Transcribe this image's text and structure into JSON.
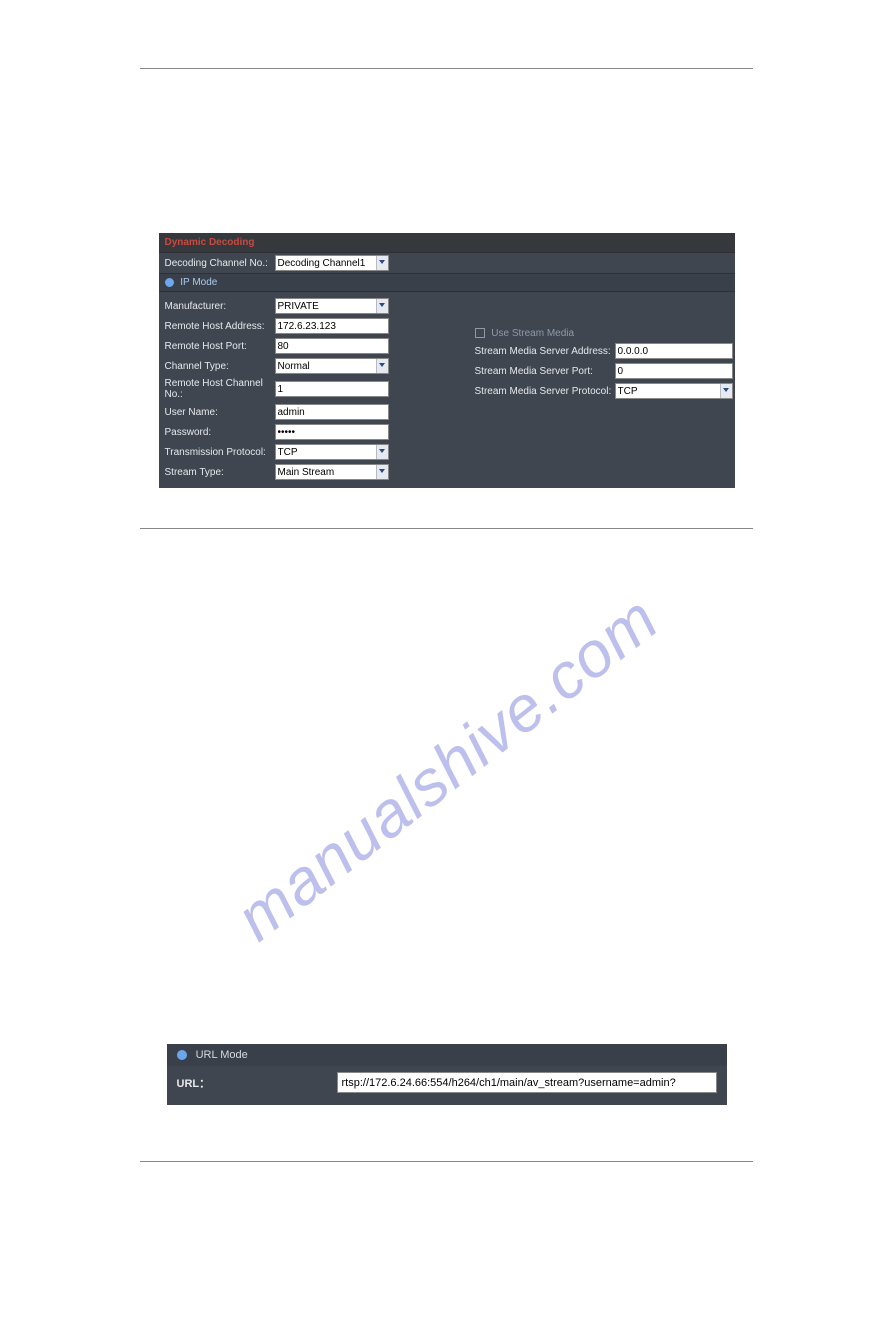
{
  "panel1": {
    "title": "Dynamic Decoding",
    "decode_channel_row": {
      "label": "Decoding Channel No.:",
      "value": "Decoding Channel1"
    },
    "ip_mode_label": "IP Mode",
    "left": {
      "manufacturer": {
        "label": "Manufacturer:",
        "value": "PRIVATE"
      },
      "remote_host_addr": {
        "label": "Remote Host Address:",
        "value": "172.6.23.123"
      },
      "remote_host_port": {
        "label": "Remote Host Port:",
        "value": "80"
      },
      "channel_type": {
        "label": "Channel Type:",
        "value": "Normal"
      },
      "remote_channel_no": {
        "label": "Remote Host Channel No.:",
        "value": "1"
      },
      "user_name": {
        "label": "User Name:",
        "value": "admin"
      },
      "password": {
        "label": "Password:",
        "value": "•••••"
      },
      "trans_proto": {
        "label": "Transmission Protocol:",
        "value": "TCP"
      },
      "stream_type": {
        "label": "Stream Type:",
        "value": "Main Stream"
      }
    },
    "right": {
      "use_sm_label": "Use Stream Media",
      "sm_addr": {
        "label": "Stream Media Server Address:",
        "value": "0.0.0.0"
      },
      "sm_port": {
        "label": "Stream Media Server Port:",
        "value": "0"
      },
      "sm_proto": {
        "label": "Stream Media Server Protocol:",
        "value": "TCP"
      }
    }
  },
  "watermark": "manualshive.com",
  "panel2": {
    "mode_label": "URL Mode",
    "url_label": "URL：",
    "url_value": "rtsp://172.6.24.66:554/h264/ch1/main/av_stream?username=admin?"
  }
}
